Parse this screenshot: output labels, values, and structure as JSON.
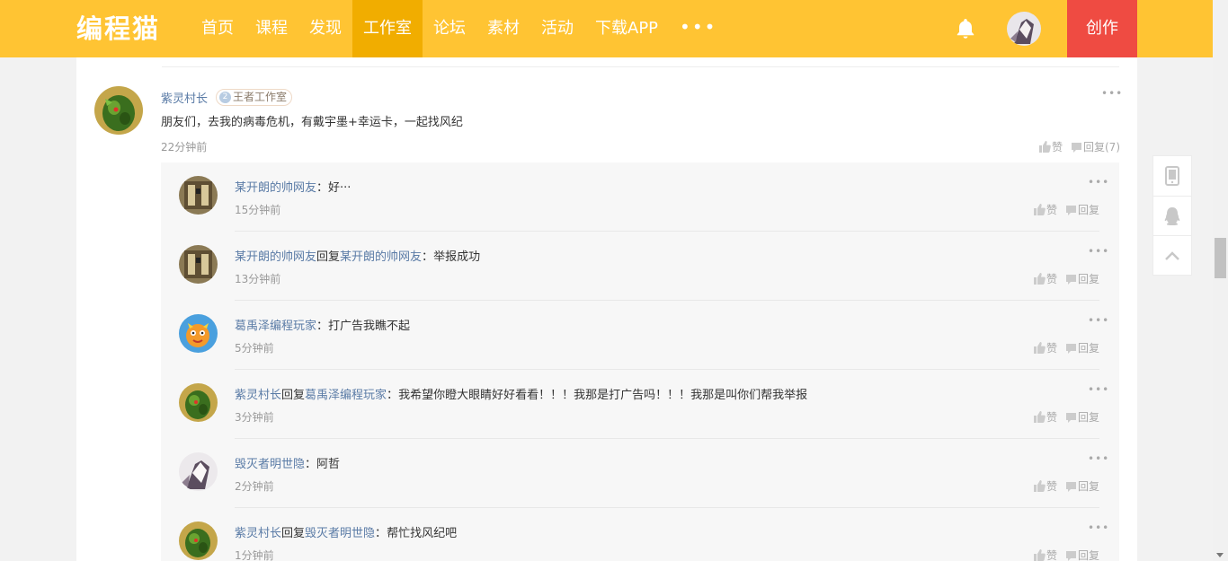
{
  "header": {
    "logo": "编程猫",
    "nav": [
      "首页",
      "课程",
      "发现",
      "工作室",
      "论坛",
      "素材",
      "活动",
      "下载APP"
    ],
    "active_nav": "工作室",
    "more": "•••",
    "create": "创作"
  },
  "comment": {
    "author": "紫灵村长",
    "badge": "2",
    "studio": "王者工作室",
    "content": "朋友们，去我的病毒危机，有戴宇墨+幸运卡，一起找风纪",
    "time": "22分钟前",
    "more": "•••",
    "like": "赞",
    "reply": "回复(7)"
  },
  "reply_word": "回复",
  "separator": "：",
  "replies": [
    {
      "user": "某开朗的帅网友",
      "to": "",
      "text": "好···",
      "time": "15分钟前",
      "like": "赞",
      "reply": "回复",
      "avatar": "building"
    },
    {
      "user": "某开朗的帅网友",
      "to": "某开朗的帅网友",
      "text": "举报成功",
      "time": "13分钟前",
      "like": "赞",
      "reply": "回复",
      "avatar": "building"
    },
    {
      "user": "葛禹泽编程玩家",
      "to": "",
      "text": "打广告我瞧不起",
      "time": "5分钟前",
      "like": "赞",
      "reply": "回复",
      "avatar": "cartoon"
    },
    {
      "user": "紫灵村长",
      "to": "葛禹泽编程玩家",
      "text": "我希望你瞪大眼睛好好看看！！！我那是打广告吗！！！我那是叫你们帮我举报",
      "time": "3分钟前",
      "like": "赞",
      "reply": "回复",
      "avatar": "lizard"
    },
    {
      "user": "毁灭者明世隐",
      "to": "",
      "text": "阿哲",
      "time": "2分钟前",
      "like": "赞",
      "reply": "回复",
      "avatar": "warrior"
    },
    {
      "user": "紫灵村长",
      "to": "毁灭者明世隐",
      "text": "帮忙找风纪吧",
      "time": "1分钟前",
      "like": "赞",
      "reply": "回复",
      "avatar": "lizard"
    }
  ],
  "colors": {
    "header_bg": "#ffc433",
    "active_nav_bg": "#f1ad00",
    "create_bg": "#ef4b42",
    "username": "#5a7ba6"
  }
}
